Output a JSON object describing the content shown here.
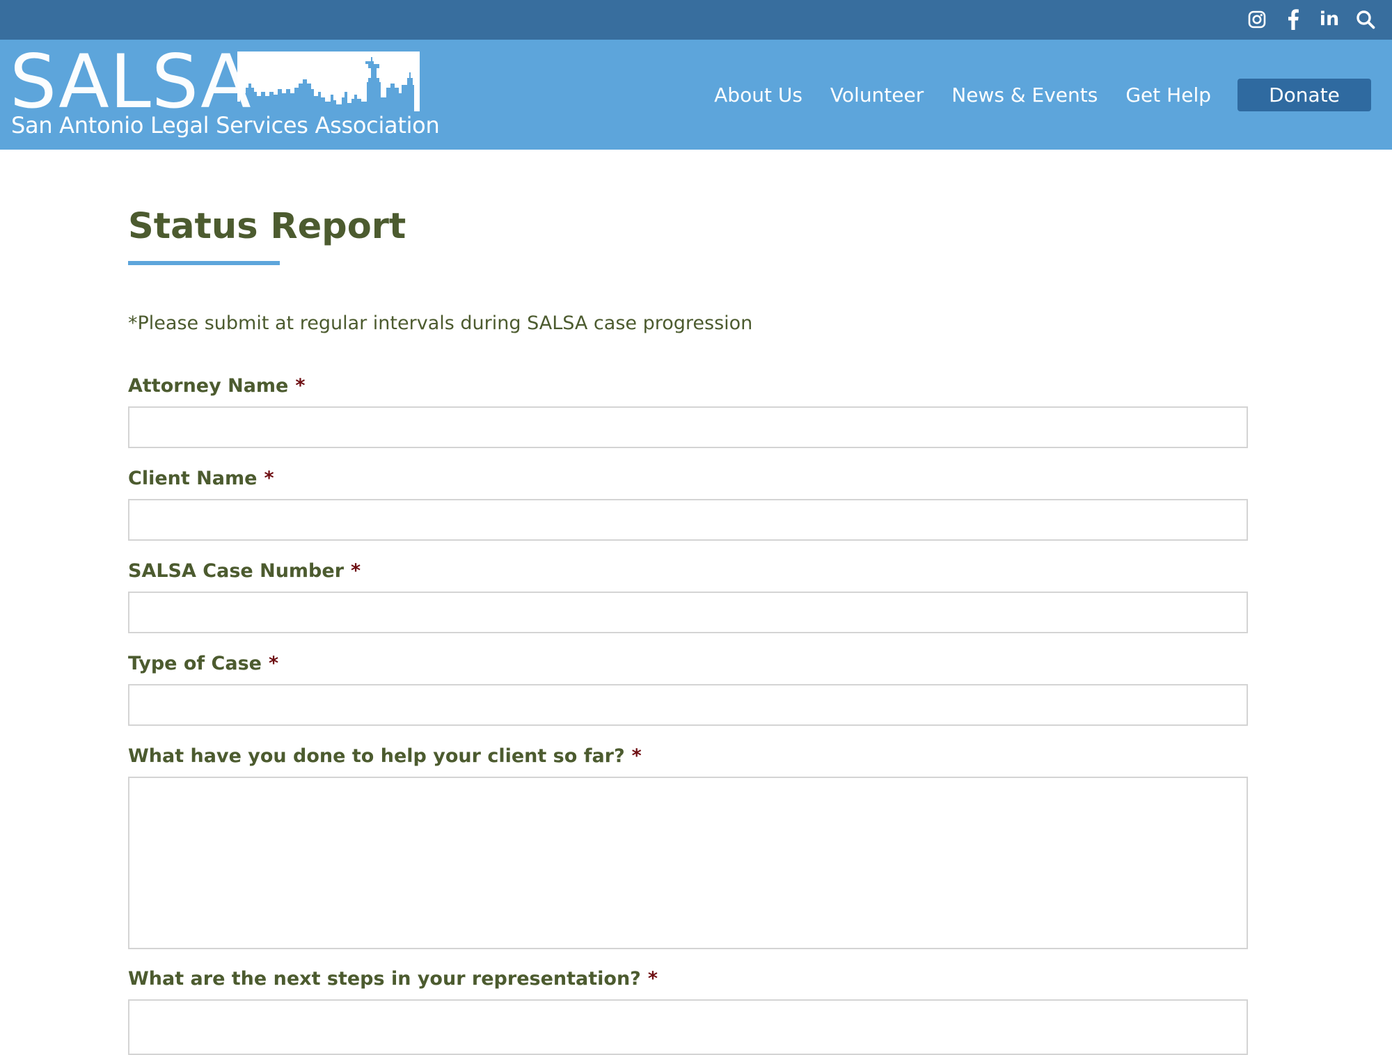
{
  "colors": {
    "top_bar": "#386e9e",
    "header": "#5da5db",
    "donate_button": "#2f6aa0",
    "heading_text": "#4c5b2f",
    "required_marker": "#6e0e12",
    "title_underline": "#5da5db",
    "input_border": "#d4d4d4"
  },
  "topbar": {
    "icons": [
      "instagram-icon",
      "facebook-icon",
      "linkedin-icon",
      "search-icon"
    ],
    "linkedin_glyph": "in"
  },
  "header": {
    "logo": {
      "wordmark": "SALSA",
      "tagline": "San Antonio Legal Services Association"
    },
    "nav": [
      {
        "label": "About Us"
      },
      {
        "label": "Volunteer"
      },
      {
        "label": "News & Events"
      },
      {
        "label": "Get Help"
      }
    ],
    "donate_label": "Donate"
  },
  "page": {
    "title": "Status Report",
    "intro": "*Please submit at regular intervals during SALSA case progression"
  },
  "form": {
    "required_marker": "*",
    "fields": [
      {
        "label": "Attorney Name",
        "value": "",
        "type": "text"
      },
      {
        "label": "Client Name",
        "value": "",
        "type": "text"
      },
      {
        "label": "SALSA Case Number",
        "value": "",
        "type": "text"
      },
      {
        "label": "Type of Case",
        "value": "",
        "type": "text"
      },
      {
        "label": "What have you done to help your client so far?",
        "value": "",
        "type": "textarea"
      },
      {
        "label": "What are the next steps in your representation?",
        "value": "",
        "type": "textarea"
      }
    ]
  }
}
